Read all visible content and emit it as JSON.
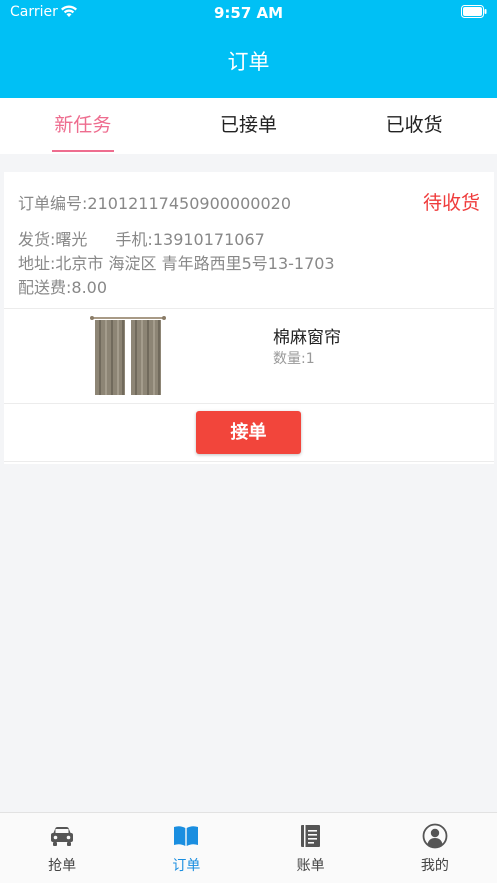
{
  "status_bar": {
    "carrier": "Carrier",
    "time": "9:57 AM"
  },
  "header": {
    "title": "订单",
    "color": "#00c0f5"
  },
  "tabs": [
    {
      "label": "新任务",
      "active": true
    },
    {
      "label": "已接单",
      "active": false
    },
    {
      "label": "已收货",
      "active": false
    }
  ],
  "order": {
    "number_label": "订单编号:",
    "number": "21012117450900000020",
    "status": "待收货",
    "shipper_label": "发货:",
    "shipper": "曙光",
    "phone_label": "手机:",
    "phone": "13910171067",
    "address_label": "地址:",
    "address": "北京市 海淀区 青年路西里5号13-1703",
    "fee_label": "配送费:",
    "fee": "8.00",
    "product": {
      "name": "棉麻窗帘",
      "qty_label": "数量:",
      "qty": "1"
    },
    "accept_label": "接单"
  },
  "tabbar": [
    {
      "label": "抢单",
      "icon": "car-icon",
      "active": false
    },
    {
      "label": "订单",
      "icon": "book-icon",
      "active": true
    },
    {
      "label": "账单",
      "icon": "ledger-icon",
      "active": false
    },
    {
      "label": "我的",
      "icon": "user-icon",
      "active": false
    }
  ],
  "colors": {
    "accent_pink": "#ee6d8f",
    "status_red": "#ef3b3b",
    "button_red": "#f2453b",
    "tabbar_active": "#1a8ee0"
  }
}
